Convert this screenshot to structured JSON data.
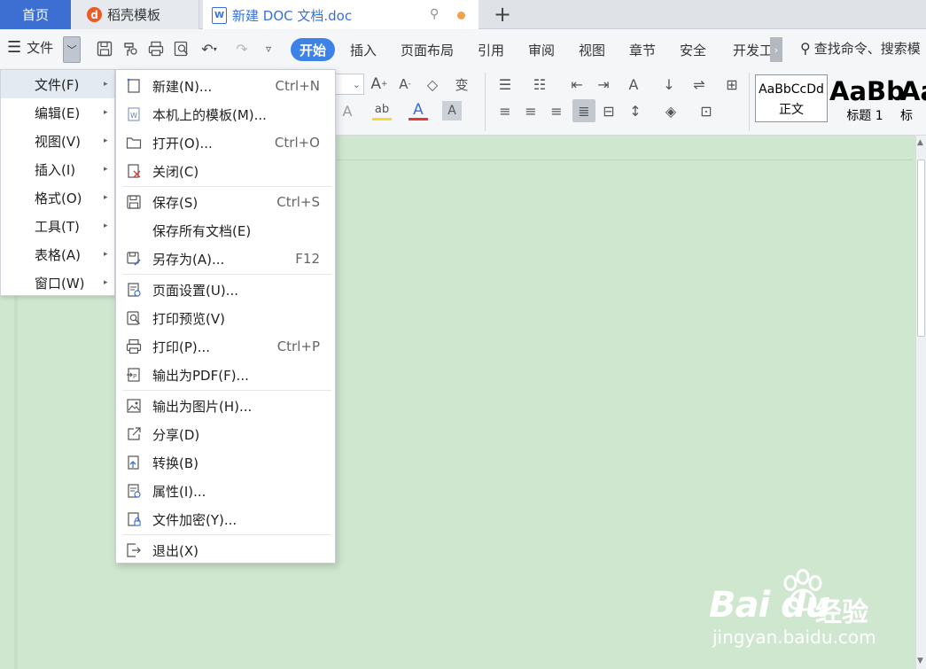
{
  "tabs": {
    "home": "首页",
    "template": "稻壳模板",
    "document": "新建 DOC 文档.doc",
    "new_tab_symbol": "+"
  },
  "ribbon": {
    "file_label": "文件",
    "tabs": [
      "开始",
      "插入",
      "页面布局",
      "引用",
      "审阅",
      "视图",
      "章节",
      "安全",
      "开发工"
    ],
    "active_tab": "开始",
    "search_text": "查找命令、搜索模"
  },
  "styles_gallery": [
    {
      "sample": "AaBbCcDd",
      "name": "正文"
    },
    {
      "sample": "AaBb",
      "name": "标题 1"
    },
    {
      "sample": "Aa",
      "name": "标"
    }
  ],
  "main_menu": [
    {
      "label": "文件(F)"
    },
    {
      "label": "编辑(E)"
    },
    {
      "label": "视图(V)"
    },
    {
      "label": "插入(I)"
    },
    {
      "label": "格式(O)"
    },
    {
      "label": "工具(T)"
    },
    {
      "label": "表格(A)"
    },
    {
      "label": "窗口(W)"
    }
  ],
  "file_menu": [
    {
      "label": "新建(N)...",
      "shortcut": "Ctrl+N",
      "icon": "new-doc-icon"
    },
    {
      "label": "本机上的模板(M)...",
      "shortcut": "",
      "icon": "template-icon"
    },
    {
      "label": "打开(O)...",
      "shortcut": "Ctrl+O",
      "icon": "folder-open-icon"
    },
    {
      "label": "关闭(C)",
      "shortcut": "",
      "icon": "close-doc-icon"
    },
    {
      "label": "保存(S)",
      "shortcut": "Ctrl+S",
      "icon": "save-icon"
    },
    {
      "label": "保存所有文档(E)",
      "shortcut": "",
      "icon": ""
    },
    {
      "label": "另存为(A)...",
      "shortcut": "F12",
      "icon": "save-as-icon"
    },
    {
      "label": "页面设置(U)...",
      "shortcut": "",
      "icon": "page-setup-icon"
    },
    {
      "label": "打印预览(V)",
      "shortcut": "",
      "icon": "print-preview-icon"
    },
    {
      "label": "打印(P)...",
      "shortcut": "Ctrl+P",
      "icon": "printer-icon"
    },
    {
      "label": "输出为PDF(F)...",
      "shortcut": "",
      "icon": "pdf-icon"
    },
    {
      "label": "输出为图片(H)...",
      "shortcut": "",
      "icon": "image-icon"
    },
    {
      "label": "分享(D)",
      "shortcut": "",
      "icon": "share-icon"
    },
    {
      "label": "转换(B)",
      "shortcut": "",
      "icon": "convert-icon"
    },
    {
      "label": "属性(I)...",
      "shortcut": "",
      "icon": "properties-icon"
    },
    {
      "label": "文件加密(Y)...",
      "shortcut": "",
      "icon": "encrypt-icon"
    },
    {
      "label": "退出(X)",
      "shortcut": "",
      "icon": "exit-icon"
    }
  ],
  "watermark": {
    "logo": "Bai du",
    "text": "经验",
    "url": "jingyan.baidu.com"
  },
  "colors": {
    "accent": "#3d82e6",
    "home_tab": "#3d6fd3",
    "document_bg": "#cfe6cf",
    "unsaved_dot": "#f0a24b"
  }
}
